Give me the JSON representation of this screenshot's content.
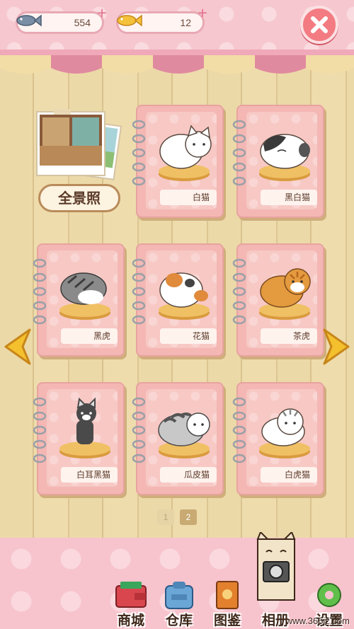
{
  "resources": {
    "fish": {
      "value": "554"
    },
    "gold_fish": {
      "value": "12"
    }
  },
  "panorama": {
    "label": "全景照"
  },
  "cats": [
    {
      "name": "白猫"
    },
    {
      "name": "黑白猫"
    },
    {
      "name": "黑虎"
    },
    {
      "name": "花猫"
    },
    {
      "name": "茶虎"
    },
    {
      "name": "白耳黑猫"
    },
    {
      "name": "瓜皮猫"
    },
    {
      "name": "白虎猫"
    }
  ],
  "pagination": {
    "pages": [
      "1",
      "2"
    ],
    "current": "2"
  },
  "nav": {
    "shop": "商城",
    "warehouse": "仓库",
    "album": "图鉴",
    "photo": "相册",
    "settings": "设置"
  },
  "watermark": "www.365jz.com",
  "colors": {
    "accent_pink": "#f37b82",
    "card_pink": "#f4b7b3",
    "bar_pink": "#f7c3cd"
  }
}
